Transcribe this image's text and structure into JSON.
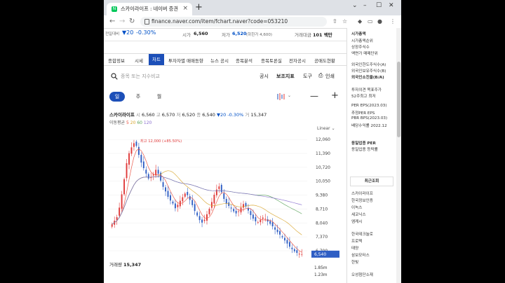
{
  "browser": {
    "tab_title": "스카이라이프 : 네이버 증권",
    "tab_favicon": "N",
    "tab_close": "×",
    "new_tab": "+",
    "url": "finance.naver.com/item/fchart.naver?code=053210",
    "window_controls": [
      "⌄",
      "–",
      "☐",
      "✕"
    ],
    "nav": {
      "back": "←",
      "forward": "→",
      "reload": "↻"
    },
    "toolbar_icons": [
      "⇧",
      "☆",
      "◆",
      "▭",
      "●",
      "⋮"
    ]
  },
  "topinfo": {
    "prev_label": "전일대비",
    "change": "▼20",
    "pct": "-0.30%",
    "open_label": "시가",
    "open": "6,560",
    "low_label": "저가",
    "low": "6,520",
    "low_limit": "(하한가 4,600)",
    "amount_label": "거래대금",
    "amount": "101 백만"
  },
  "menu": [
    "종합정보",
    "시세",
    "차트",
    "투자자별 매매동향",
    "뉴스 공시",
    "종목분석",
    "종목토론실",
    "전자공시",
    "공매도현황"
  ],
  "search": {
    "placeholder": "종목 또는 지수비교",
    "links": [
      "공시",
      "보조지표",
      "도구",
      "인쇄"
    ]
  },
  "periods": [
    "일",
    "주",
    "월"
  ],
  "stock": {
    "name": "스카이라이프",
    "open_label": "시",
    "open": "6,560",
    "high_label": "고",
    "high": "6,570",
    "low_label": "저",
    "low": "6,520",
    "close_label": "종",
    "close": "6,540",
    "change": "▼20",
    "pct": "-0.30%",
    "vol_label": "거",
    "vol": "15,347"
  },
  "ma_legend": {
    "label": "이동평균",
    "items": [
      "5",
      "20",
      "60",
      "120"
    ],
    "colors": [
      "#e94d3c",
      "#d8a52d",
      "#5ba35c",
      "#8a6fcf"
    ]
  },
  "scale": "Linear",
  "chart_data": {
    "type": "candlestick",
    "y_ticks": [
      "12,060",
      "11,390",
      "10,720",
      "10,050",
      "9,380",
      "8,710",
      "8,040",
      "7,370",
      "6,700"
    ],
    "ylim": [
      6500,
      12300
    ],
    "high_annotation": "최고 12,000 (+85.50%)",
    "low_annotation": "최저 6,490 (0.77%)",
    "current_price": "6,540",
    "up_color": "#e03a3a",
    "down_color": "#2f5ec4",
    "closes": [
      7980,
      8150,
      8320,
      8780,
      9420,
      10150,
      10920,
      11400,
      11680,
      11880,
      11750,
      11320,
      10950,
      10680,
      10420,
      10180,
      10250,
      10380,
      10600,
      10410,
      10080,
      9780,
      9560,
      9300,
      9120,
      8980,
      8750,
      8920,
      9110,
      9280,
      9460,
      9380,
      9150,
      8900,
      8620,
      8400,
      8180,
      8060,
      8200,
      8460,
      8720,
      9050,
      9400,
      9650,
      9800,
      9520,
      9200,
      8980,
      8860,
      8740,
      8600,
      8500,
      8600,
      8780,
      8950,
      8830,
      8640,
      8420,
      8250,
      8120,
      8080,
      8190,
      8300,
      8240,
      8110,
      8000,
      7880,
      7720,
      7600,
      7480,
      7350,
      7200,
      7050,
      6900,
      6780,
      6680,
      6600,
      6560,
      6540
    ]
  },
  "volume": {
    "label": "거래량",
    "value": "15,347",
    "axis": [
      "1.85m",
      "1.23m"
    ]
  },
  "sidebar": {
    "items": [
      "시가총액",
      "시가총액순위",
      "상장주식수",
      "액면가 매매단위",
      "외국인한도주식수(A)",
      "외국인보유주식수(B)",
      "외국인소진율(B/A)",
      "투자의견 목표주가",
      "52주최고 최저",
      "PER EPS(2023.03)",
      "추정PER EPS",
      "PBR BPS(2023.03)",
      "배당수익률 2022.12",
      "동일업종 PER",
      "동일업종 등락률"
    ],
    "recent_title": "최근조회",
    "recent": [
      "스카이라이프",
      "한국정보인증",
      "이녹스",
      "세코닉스",
      "엠케시",
      "한국테크놀로",
      "프로텍",
      "태양",
      "삼보모터스",
      "한빛",
      "오성첨단소재"
    ]
  }
}
